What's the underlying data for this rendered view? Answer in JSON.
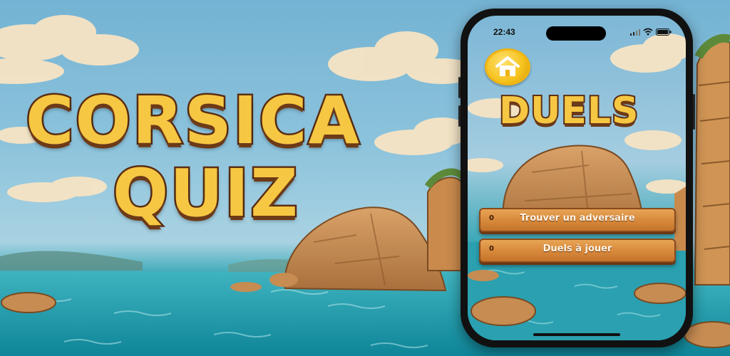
{
  "hero": {
    "title_line1": "CORSICA",
    "title_line2": "QUIZ"
  },
  "phone": {
    "status_bar": {
      "time": "22:43",
      "icons": [
        "signal-icon",
        "wifi-icon",
        "battery-icon"
      ]
    },
    "home_button_icon": "house-icon",
    "screen_title": "DUELS",
    "actions": [
      {
        "count": "0",
        "label": "Trouver un adversaire"
      },
      {
        "count": "0",
        "label": "Duels à jouer"
      }
    ]
  },
  "colors": {
    "title_fill": "#f6c742",
    "title_outline": "#5b2e14",
    "plank_wood": "#d88a3c",
    "home_button_gold": "#f5c21c"
  }
}
